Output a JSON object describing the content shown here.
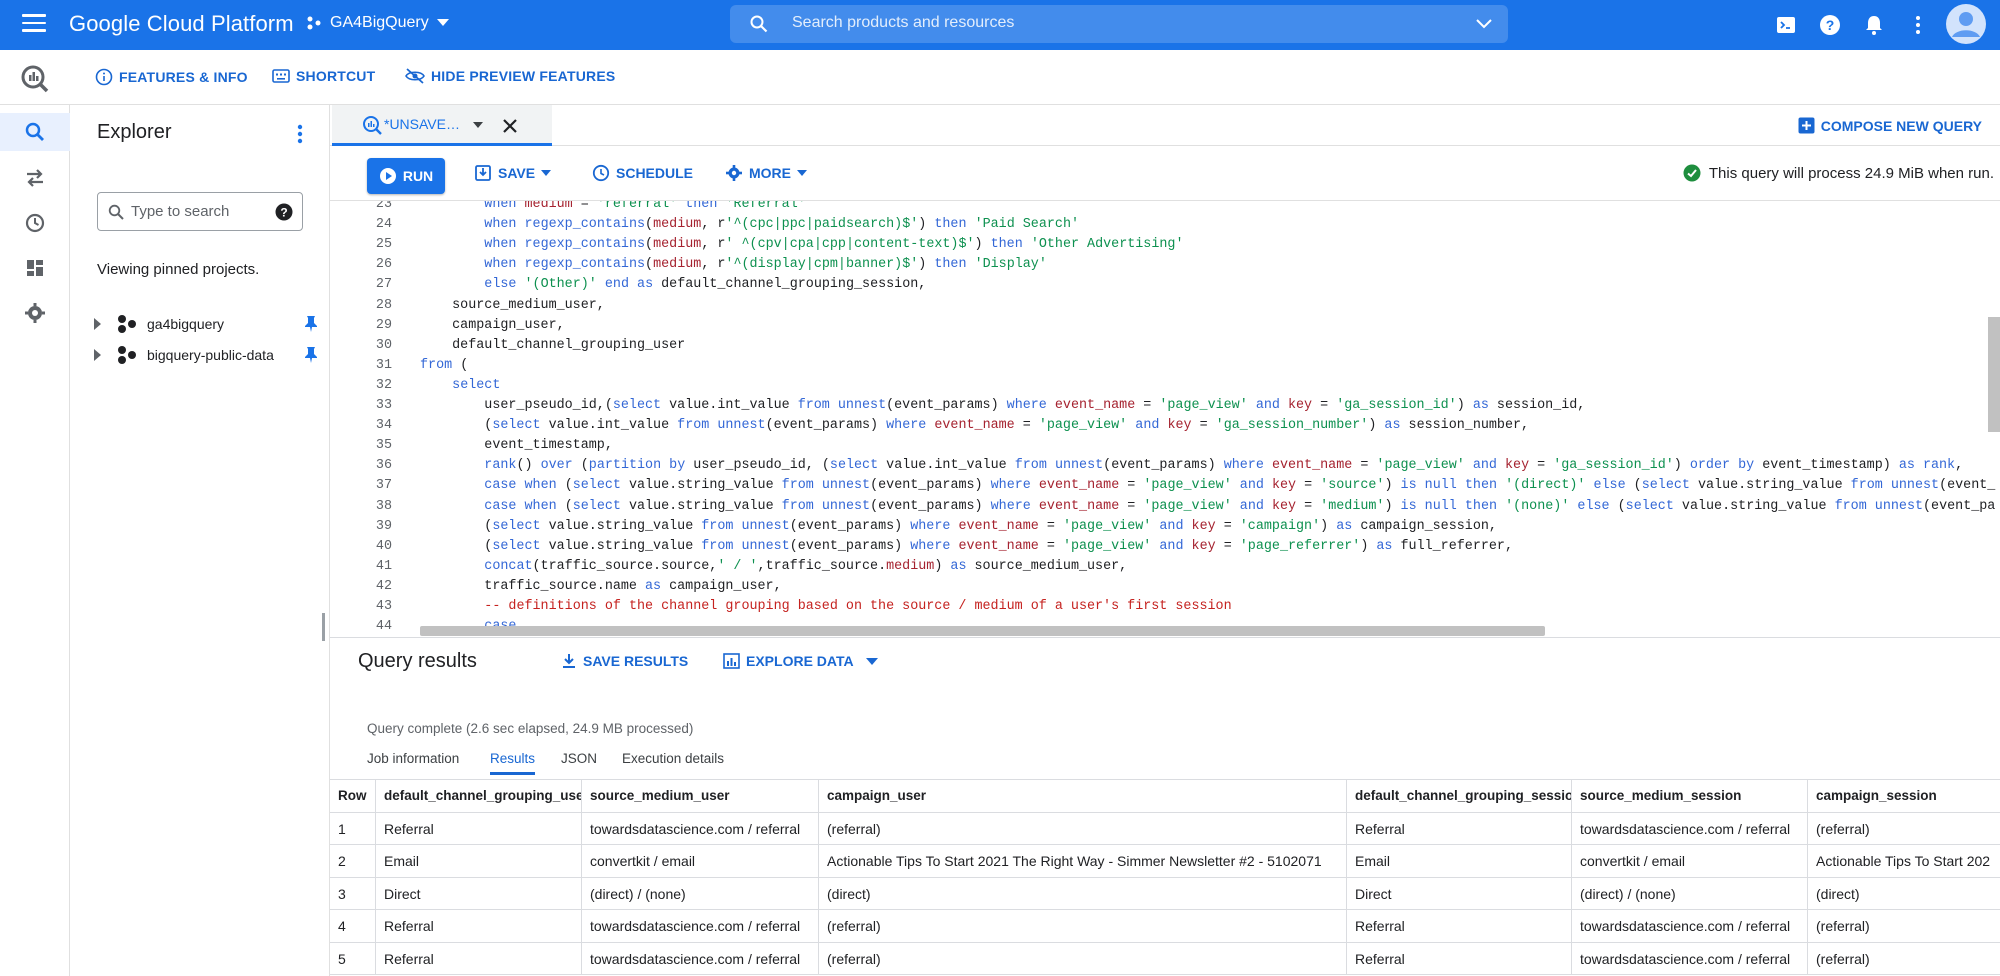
{
  "topbar": {
    "app_title": "Google Cloud Platform",
    "project": "GA4BigQuery",
    "search_placeholder": "Search products and resources"
  },
  "subbar": {
    "features": "FEATURES & INFO",
    "shortcut": "SHORTCUT",
    "hide_preview": "HIDE PREVIEW FEATURES"
  },
  "explorer": {
    "title": "Explorer",
    "search_placeholder": "Type to search",
    "pinned_text": "Viewing pinned projects.",
    "projects": [
      "ga4bigquery",
      "bigquery-public-data"
    ]
  },
  "tabs": {
    "query_tab": "*UNSAVE…",
    "compose": "COMPOSE NEW QUERY"
  },
  "toolbar": {
    "run": "RUN",
    "save": "SAVE",
    "schedule": "SCHEDULE",
    "more": "MORE",
    "process_msg": "This query will process 24.9 MiB when run."
  },
  "editor": {
    "lines": [
      {
        "n": "23",
        "t": "        when medium = 'referral' then 'Referral'"
      },
      {
        "n": "24",
        "t": "        when regexp_contains(medium, r'^(cpc|ppc|paidsearch)$') then 'Paid Search'"
      },
      {
        "n": "25",
        "t": "        when regexp_contains(medium, r' ^(cpv|cpa|cpp|content-text)$') then 'Other Advertising'"
      },
      {
        "n": "26",
        "t": "        when regexp_contains(medium, r'^(display|cpm|banner)$') then 'Display'"
      },
      {
        "n": "27",
        "t": "        else '(Other)' end as default_channel_grouping_session,"
      },
      {
        "n": "28",
        "t": "    source_medium_user,"
      },
      {
        "n": "29",
        "t": "    campaign_user,"
      },
      {
        "n": "30",
        "t": "    default_channel_grouping_user"
      },
      {
        "n": "31",
        "t": "from ("
      },
      {
        "n": "32",
        "t": "    select"
      },
      {
        "n": "33",
        "t": "        user_pseudo_id,(select value.int_value from unnest(event_params) where event_name = 'page_view' and key = 'ga_session_id') as session_id,"
      },
      {
        "n": "34",
        "t": "        (select value.int_value from unnest(event_params) where event_name = 'page_view' and key = 'ga_session_number') as session_number,"
      },
      {
        "n": "35",
        "t": "        event_timestamp,"
      },
      {
        "n": "36",
        "t": "        rank() over (partition by user_pseudo_id, (select value.int_value from unnest(event_params) where event_name = 'page_view' and key = 'ga_session_id') order by event_timestamp) as rank,"
      },
      {
        "n": "37",
        "t": "        case when (select value.string_value from unnest(event_params) where event_name = 'page_view' and key = 'source') is null then '(direct)' else (select value.string_value from unnest(event_"
      },
      {
        "n": "38",
        "t": "        case when (select value.string_value from unnest(event_params) where event_name = 'page_view' and key = 'medium') is null then '(none)' else (select value.string_value from unnest(event_pa"
      },
      {
        "n": "39",
        "t": "        (select value.string_value from unnest(event_params) where event_name = 'page_view' and key = 'campaign') as campaign_session,"
      },
      {
        "n": "40",
        "t": "        (select value.string_value from unnest(event_params) where event_name = 'page_view' and key = 'page_referrer') as full_referrer,"
      },
      {
        "n": "41",
        "t": "        concat(traffic_source.source,' / ',traffic_source.medium) as source_medium_user,"
      },
      {
        "n": "42",
        "t": "        traffic_source.name as campaign_user,"
      },
      {
        "n": "43",
        "t": "        -- definitions of the channel grouping based on the source / medium of a user's first session"
      },
      {
        "n": "44",
        "t": "        case"
      }
    ]
  },
  "results": {
    "title": "Query results",
    "save_results": "SAVE RESULTS",
    "explore": "EXPLORE DATA",
    "status": "Query complete (2.6 sec elapsed, 24.9 MB processed)",
    "tabs": [
      "Job information",
      "Results",
      "JSON",
      "Execution details"
    ],
    "columns": [
      "Row",
      "default_channel_grouping_user",
      "source_medium_user",
      "campaign_user",
      "default_channel_grouping_session",
      "source_medium_session",
      "campaign_session"
    ],
    "rows": [
      [
        "1",
        "Referral",
        "towardsdatascience.com / referral",
        "(referral)",
        "Referral",
        "towardsdatascience.com / referral",
        "(referral)"
      ],
      [
        "2",
        "Email",
        "convertkit / email",
        "Actionable Tips To Start 2021 The Right Way - Simmer Newsletter #2 - 5102071",
        "Email",
        "convertkit / email",
        "Actionable Tips To Start 202"
      ],
      [
        "3",
        "Direct",
        "(direct) / (none)",
        "(direct)",
        "Direct",
        "(direct) / (none)",
        "(direct)"
      ],
      [
        "4",
        "Referral",
        "towardsdatascience.com / referral",
        "(referral)",
        "Referral",
        "towardsdatascience.com / referral",
        "(referral)"
      ],
      [
        "5",
        "Referral",
        "towardsdatascience.com / referral",
        "(referral)",
        "Referral",
        "towardsdatascience.com / referral",
        "(referral)"
      ]
    ]
  },
  "icons": {
    "menu": "menu-icon",
    "project": "project-hub-icon",
    "search": "search-icon",
    "terminal": "terminal-icon",
    "help": "help-icon",
    "notifications": "bell-icon",
    "more": "more-vert-icon",
    "account": "account-icon"
  },
  "colors": {
    "brand": "#1a73e8",
    "link": "#1967d2",
    "success": "#1e8e3e"
  }
}
